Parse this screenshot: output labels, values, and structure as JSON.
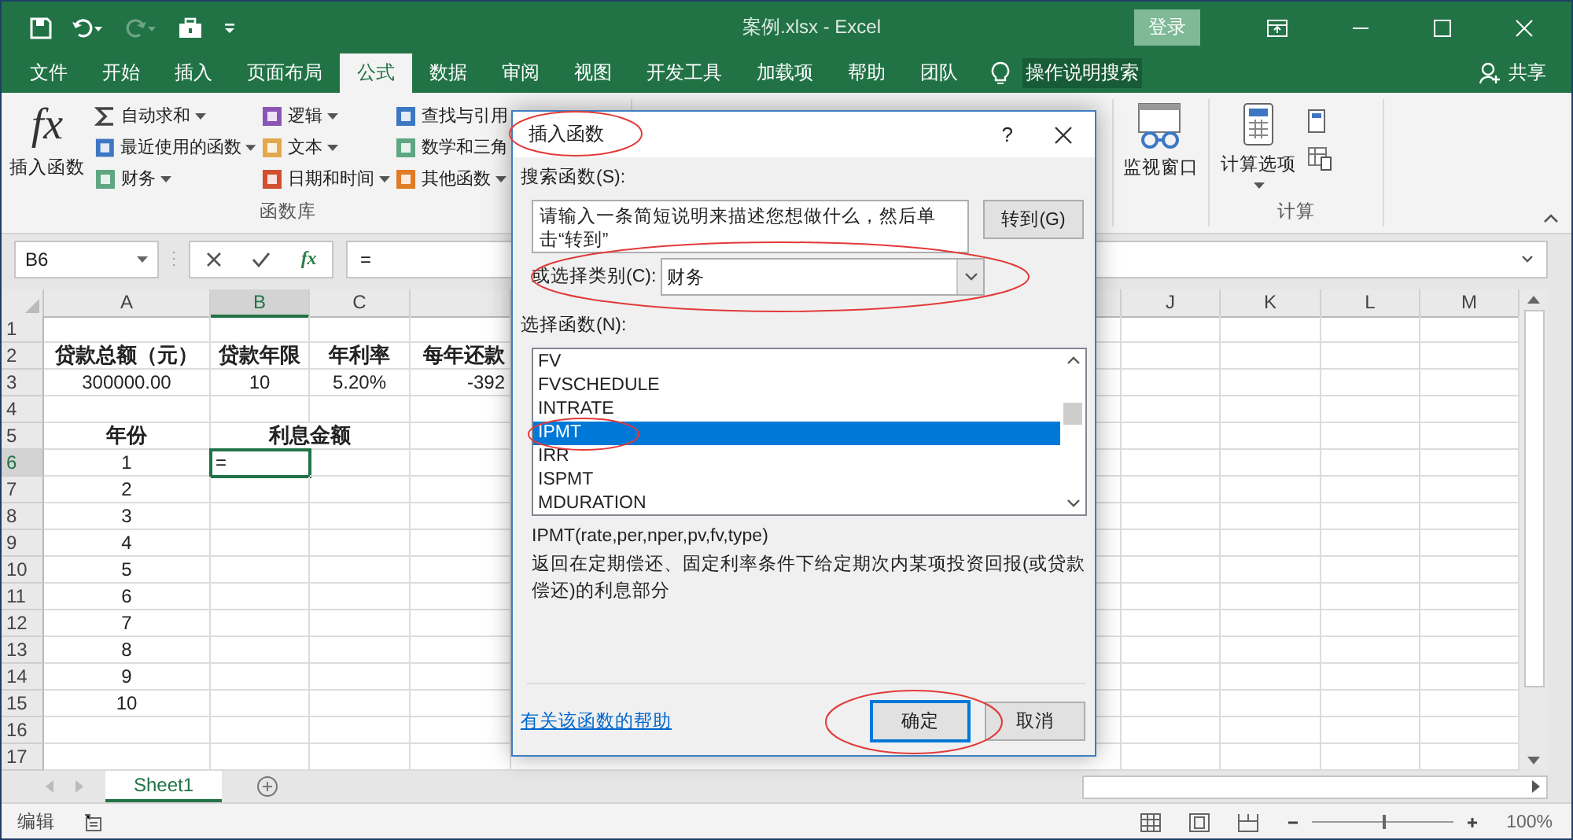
{
  "window": {
    "title": "案例.xlsx  -  Excel",
    "login": "登录"
  },
  "tabs": [
    {
      "label": "文件",
      "selected": false
    },
    {
      "label": "开始",
      "selected": false
    },
    {
      "label": "插入",
      "selected": false
    },
    {
      "label": "页面布局",
      "selected": false
    },
    {
      "label": "公式",
      "selected": true
    },
    {
      "label": "数据",
      "selected": false
    },
    {
      "label": "审阅",
      "selected": false
    },
    {
      "label": "视图",
      "selected": false
    },
    {
      "label": "开发工具",
      "selected": false
    },
    {
      "label": "加载项",
      "selected": false
    },
    {
      "label": "帮助",
      "selected": false
    },
    {
      "label": "团队",
      "selected": false
    }
  ],
  "tell_me": "操作说明搜索",
  "share": "共享",
  "ribbon": {
    "fx_glyph": "fx",
    "insert_function": "插入函数",
    "function_columns": [
      [
        {
          "label": "自动求和",
          "caret": true
        },
        {
          "label": "最近使用的函数",
          "caret": true
        },
        {
          "label": "财务",
          "caret": true
        }
      ],
      [
        {
          "label": "逻辑",
          "caret": true
        },
        {
          "label": "文本",
          "caret": true
        },
        {
          "label": "日期和时间",
          "caret": true
        }
      ],
      [
        {
          "label": "查找与引用",
          "caret": false
        },
        {
          "label": "数学和三角",
          "caret": false
        },
        {
          "label": "其他函数",
          "caret": true
        }
      ]
    ],
    "library_group": "函数库",
    "watch_window": "监视窗口",
    "calc_options": "计算选项",
    "calc_group": "计算"
  },
  "formula_bar": {
    "name_box": "B6",
    "fx": "fx",
    "formula": "="
  },
  "sheet": {
    "left_columns": [
      "A",
      "B",
      "C"
    ],
    "right_columns": [
      "J",
      "K",
      "L",
      "M"
    ],
    "rows": [
      {
        "number": "1"
      },
      {
        "number": "2",
        "A": {
          "text": "贷款总额（元）",
          "bold": true
        },
        "B": {
          "text": "贷款年限",
          "bold": true
        },
        "C": {
          "text": "年利率",
          "bold": true
        },
        "D": {
          "text": "每年还款",
          "bold": true
        }
      },
      {
        "number": "3",
        "A": {
          "text": "300000.00",
          "bold": false
        },
        "B": {
          "text": "10",
          "bold": false
        },
        "C": {
          "text": "5.20%",
          "bold": false
        },
        "D": {
          "text": "-392",
          "bold": false
        }
      },
      {
        "number": "4"
      },
      {
        "number": "5",
        "A": {
          "text": "年份",
          "bold": true
        },
        "B": {
          "text": "利息金额",
          "bold": true,
          "merged": true
        }
      },
      {
        "number": "6",
        "A": {
          "text": "1",
          "bold": false
        },
        "B": {
          "text": "=",
          "bold": false,
          "active": true
        }
      },
      {
        "number": "7",
        "A": {
          "text": "2",
          "bold": false
        }
      },
      {
        "number": "8",
        "A": {
          "text": "3",
          "bold": false
        }
      },
      {
        "number": "9",
        "A": {
          "text": "4",
          "bold": false
        }
      },
      {
        "number": "10",
        "A": {
          "text": "5",
          "bold": false
        }
      },
      {
        "number": "11",
        "A": {
          "text": "6",
          "bold": false
        }
      },
      {
        "number": "12",
        "A": {
          "text": "7",
          "bold": false
        }
      },
      {
        "number": "13",
        "A": {
          "text": "8",
          "bold": false
        }
      },
      {
        "number": "14",
        "A": {
          "text": "9",
          "bold": false
        }
      },
      {
        "number": "15",
        "A": {
          "text": "10",
          "bold": false
        }
      },
      {
        "number": "16"
      },
      {
        "number": "17"
      }
    ]
  },
  "sheet_tabs": [
    {
      "label": "Sheet1",
      "selected": true
    }
  ],
  "status_bar": {
    "mode": "编辑",
    "zoom": {
      "level": 0.5,
      "reading": "100%"
    }
  },
  "dialog": {
    "title": "插入函数",
    "help": "?",
    "search_label": "搜索函数(S):",
    "search_value": "请输入一条简短说明来描述您想做什么，然后单击“转到”",
    "go_button": "转到(G)",
    "category_label": "或选择类别(C):",
    "category": "财务",
    "list_label": "选择函数(N):",
    "functions": [
      {
        "name": "FV",
        "selected": false
      },
      {
        "name": "FVSCHEDULE",
        "selected": false
      },
      {
        "name": "INTRATE",
        "selected": false
      },
      {
        "name": "IPMT",
        "selected": true
      },
      {
        "name": "IRR",
        "selected": false
      },
      {
        "name": "ISPMT",
        "selected": false
      },
      {
        "name": "MDURATION",
        "selected": false
      }
    ],
    "signature": "IPMT(rate,per,nper,pv,fv,type)",
    "description": "返回在定期偿还、固定利率条件下给定期次内某项投资回报(或贷款偿还)的利息部分",
    "help_link": "有关该函数的帮助",
    "ok": "确定",
    "cancel": "取消"
  }
}
